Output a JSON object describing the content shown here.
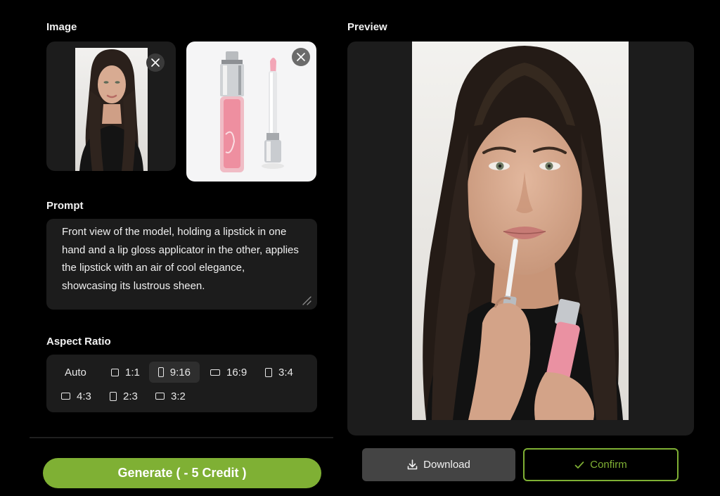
{
  "image_section": {
    "title": "Image",
    "model_photo": "model-portrait",
    "product_photo": "lip-gloss-product"
  },
  "prompt_section": {
    "title": "Prompt",
    "text": "Front view of the model, holding a lipstick in one hand and a lip gloss applicator in the other, applies the lipstick with an air of cool elegance, showcasing its lustrous sheen."
  },
  "aspect_section": {
    "title": "Aspect Ratio",
    "options": [
      "Auto",
      "1:1",
      "9:16",
      "16:9",
      "3:4",
      "4:3",
      "2:3",
      "3:2"
    ],
    "selected": "9:16"
  },
  "generate": {
    "label": "Generate ( - 5 Credit )"
  },
  "preview_section": {
    "title": "Preview"
  },
  "actions": {
    "download_label": "Download",
    "confirm_label": "Confirm"
  },
  "colors": {
    "background": "#000000",
    "panel": "#1c1c1c",
    "accent_green": "#7fb034",
    "download_bg": "#444444"
  }
}
